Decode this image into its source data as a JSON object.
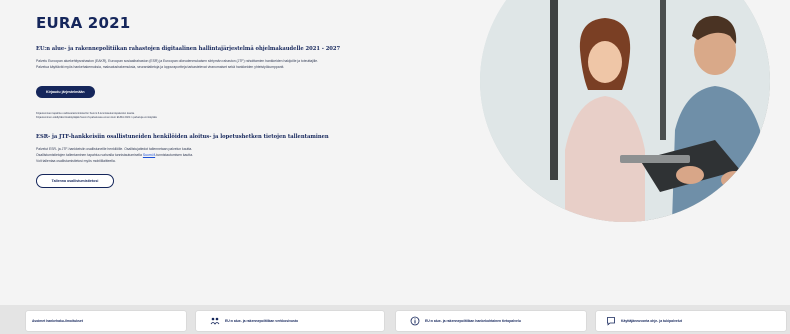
{
  "header": {
    "title": "EURA 2021"
  },
  "section1": {
    "heading": "EU:n alue- ja rakennepolitiikan rahastojen digitaalinen hallintajärjestelmä ohjelmakaudelle 2021 - 2027",
    "para1": "Palvelu Euroopan aluekehitysrahaston (EAKR), Euroopan sosiaalirahaston (ESR) ja Euroopan oikeudenmukaisen siirtymän rahaston (JTF) rahoittamien hankkeiden hakijoille ja toteuttajille.",
    "para2": "Palvelua käyttävät myös hankehakemuksia, maksatushakemuksia, seurantatietoja ja loppuraportteja tarkastelevat viranomaiset sekä hankkeiden yhteistyökumppanit.",
    "login_button": "Kirjaudu järjestelmään",
    "note1": "Kirjautumisen tapahtuu valtiovarainministeriön Suomi.fi-tunnistautumispalvelun kautta.",
    "note2": "Kirjautuminen edellyttää tiluskäyttäjää Suomi.fi-palvelussa ennen kuin EURA 2021:n palveluja voi käyttää."
  },
  "section2": {
    "heading": "ESR- ja JTF-hankkeisiin osallistuneiden henkilöiden aloitus- ja lopetushetken tietojen tallentaminen",
    "para1": "Palvelut ESR- ja JTF-hankkeisiin osallistuneille henkilöille. Osallistujatiedot tallennetaan palvelun kautta.",
    "para2_before": "Osallistumistietojen tallentaminen tapahtuu vahvalla tunnistautumisella",
    "para2_link": "Suomi.fi",
    "para2_after": "-tunnistautumisen kautta.",
    "para3": "Voit tallentaa osallistumistietosi myös mobiililaitteella.",
    "save_button": "Tallenna osallistumistietosi"
  },
  "footer": {
    "items": [
      {
        "label": "Avoimet hankehaku-ilmoitukset",
        "icon": "none"
      },
      {
        "label": "EU:n alue- ja rakennepolitiikan verkkosivusto",
        "icon": "people-icon"
      },
      {
        "label": "EU:n alue- ja rakennepolitiikan hankekohtainen tietopalvelu",
        "icon": "info-icon"
      },
      {
        "label": "Käyttäjäneuvonta ohje- ja tukipalvelut",
        "icon": "chat-icon"
      }
    ]
  },
  "colors": {
    "primary": "#15265b",
    "link": "#1a4fd6",
    "background": "#f4f4f4"
  }
}
